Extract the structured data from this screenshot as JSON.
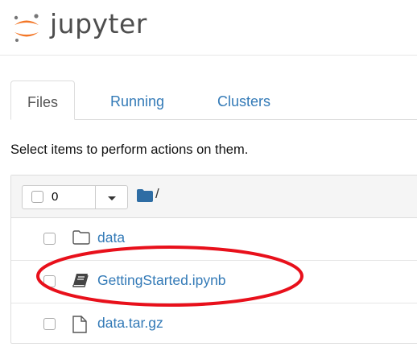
{
  "app": {
    "logo_text": "jupyter"
  },
  "tabs": [
    {
      "label": "Files",
      "active": true
    },
    {
      "label": "Running",
      "active": false
    },
    {
      "label": "Clusters",
      "active": false
    }
  ],
  "hint_text": "Select items to perform actions on them.",
  "toolbar": {
    "selected_count": "0",
    "path": "/"
  },
  "files": [
    {
      "name": "data",
      "type": "folder",
      "icon": "folder-icon"
    },
    {
      "name": "GettingStarted.ipynb",
      "type": "notebook",
      "icon": "notebook-icon"
    },
    {
      "name": "data.tar.gz",
      "type": "file",
      "icon": "file-icon"
    }
  ],
  "colors": {
    "link": "#337ab7",
    "logo_orange": "#f37626",
    "annotation_red": "#e8101b",
    "folder_blue": "#2e6da4"
  }
}
